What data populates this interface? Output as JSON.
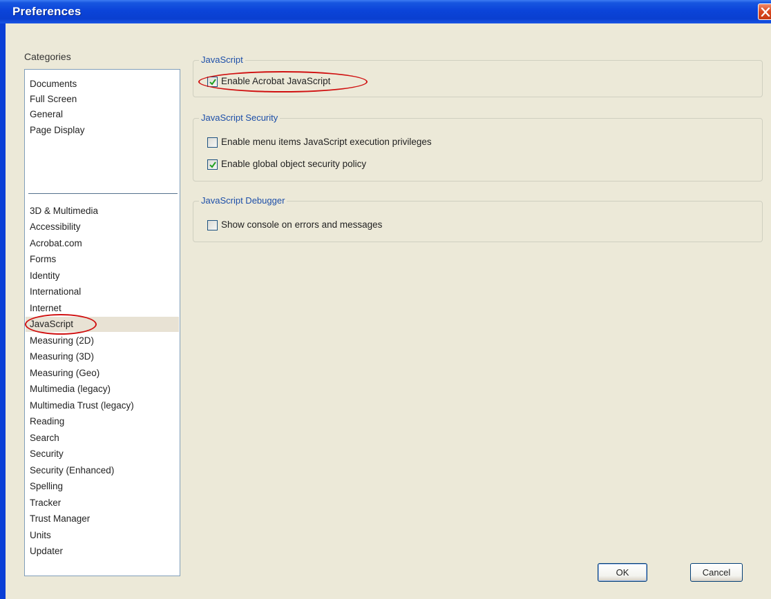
{
  "window": {
    "title": "Preferences"
  },
  "categories": {
    "label": "Categories",
    "group1": [
      "Documents",
      "Full Screen",
      "General",
      "Page Display"
    ],
    "group2": [
      "3D & Multimedia",
      "Accessibility",
      "Acrobat.com",
      "Forms",
      "Identity",
      "International",
      "Internet",
      "JavaScript",
      "Measuring (2D)",
      "Measuring (3D)",
      "Measuring (Geo)",
      "Multimedia (legacy)",
      "Multimedia Trust (legacy)",
      "Reading",
      "Search",
      "Security",
      "Security (Enhanced)",
      "Spelling",
      "Tracker",
      "Trust Manager",
      "Units",
      "Updater"
    ],
    "selected": "JavaScript"
  },
  "javascript_group": {
    "legend": "JavaScript",
    "enable_acrobat_js": {
      "label": "Enable Acrobat JavaScript",
      "checked": true
    }
  },
  "security_group": {
    "legend": "JavaScript Security",
    "menu_items_privileges": {
      "label": "Enable menu items JavaScript execution privileges",
      "checked": false
    },
    "global_object_policy": {
      "label": "Enable global object security policy",
      "checked": true
    }
  },
  "debugger_group": {
    "legend": "JavaScript Debugger",
    "show_console": {
      "label": "Show console on errors and messages",
      "checked": false
    }
  },
  "buttons": {
    "ok": "OK",
    "cancel": "Cancel"
  },
  "colors": {
    "titlebar": "#0b44d9",
    "dialog_bg": "#ece9d8",
    "annotation_red": "#d01010",
    "legend_blue": "#1c4ea8"
  }
}
